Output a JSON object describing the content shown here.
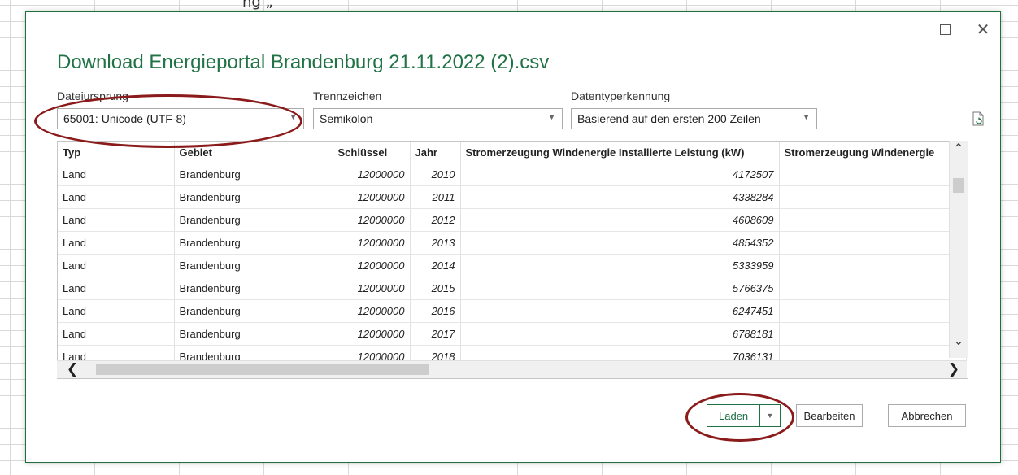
{
  "background_text": "ng                                             „",
  "dialog": {
    "title": "Download Energieportal Brandenburg 21.11.2022 (2).csv",
    "restore_icon": "restore-icon",
    "close_glyph": "✕"
  },
  "fields": {
    "dateiursprung": {
      "label": "Dateiursprung",
      "value": "65001: Unicode (UTF-8)"
    },
    "trennzeichen": {
      "label": "Trennzeichen",
      "value": "Semikolon"
    },
    "datentyperkennung": {
      "label": "Datentyperkennung",
      "value": "Basierend auf den ersten 200 Zeilen"
    }
  },
  "table": {
    "columns": [
      "Typ",
      "Gebiet",
      "Schlüssel",
      "Jahr",
      "Stromerzeugung Windenergie Installierte Leistung (kW)",
      "Stromerzeugung Windenergie"
    ],
    "rows": [
      [
        "Land",
        "Brandenburg",
        "12000000",
        "2010",
        "4172507",
        ""
      ],
      [
        "Land",
        "Brandenburg",
        "12000000",
        "2011",
        "4338284",
        ""
      ],
      [
        "Land",
        "Brandenburg",
        "12000000",
        "2012",
        "4608609",
        ""
      ],
      [
        "Land",
        "Brandenburg",
        "12000000",
        "2013",
        "4854352",
        ""
      ],
      [
        "Land",
        "Brandenburg",
        "12000000",
        "2014",
        "5333959",
        ""
      ],
      [
        "Land",
        "Brandenburg",
        "12000000",
        "2015",
        "5766375",
        ""
      ],
      [
        "Land",
        "Brandenburg",
        "12000000",
        "2016",
        "6247451",
        ""
      ],
      [
        "Land",
        "Brandenburg",
        "12000000",
        "2017",
        "6788181",
        ""
      ],
      [
        "Land",
        "Brandenburg",
        "12000000",
        "2018",
        "7036131",
        ""
      ]
    ]
  },
  "buttons": {
    "laden": "Laden",
    "bearbeiten": "Bearbeiten",
    "abbrechen": "Abbrechen"
  },
  "colors": {
    "accent_green": "#217346",
    "highlight_ring": "#8b1a1a"
  }
}
